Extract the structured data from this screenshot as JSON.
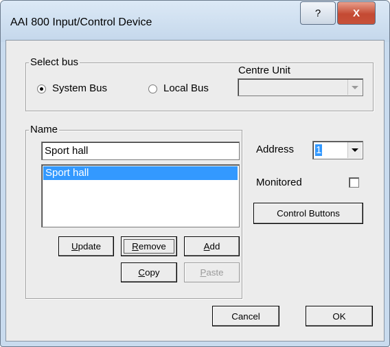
{
  "window": {
    "title": "AAI 800 Input/Control Device",
    "help_label": "?",
    "close_label": "X"
  },
  "select_bus": {
    "legend": "Select bus",
    "system_bus_label": "System Bus",
    "local_bus_label": "Local Bus",
    "selected": "System Bus",
    "centre_unit_label": "Centre Unit",
    "centre_unit_value": ""
  },
  "name_group": {
    "legend": "Name",
    "input_value": "Sport hall",
    "list_items": [
      "Sport hall"
    ],
    "selected_item": "Sport hall"
  },
  "address": {
    "label": "Address",
    "value": "1"
  },
  "monitored": {
    "label": "Monitored",
    "checked": false
  },
  "buttons": {
    "control_buttons": "Control Buttons",
    "update_u": "U",
    "update_rest": "pdate",
    "remove_u": "R",
    "remove_rest": "emove",
    "add_u": "A",
    "add_rest": "dd",
    "copy_u": "C",
    "copy_rest": "opy",
    "paste_u": "P",
    "paste_rest": "aste",
    "cancel": "Cancel",
    "ok": "OK"
  }
}
